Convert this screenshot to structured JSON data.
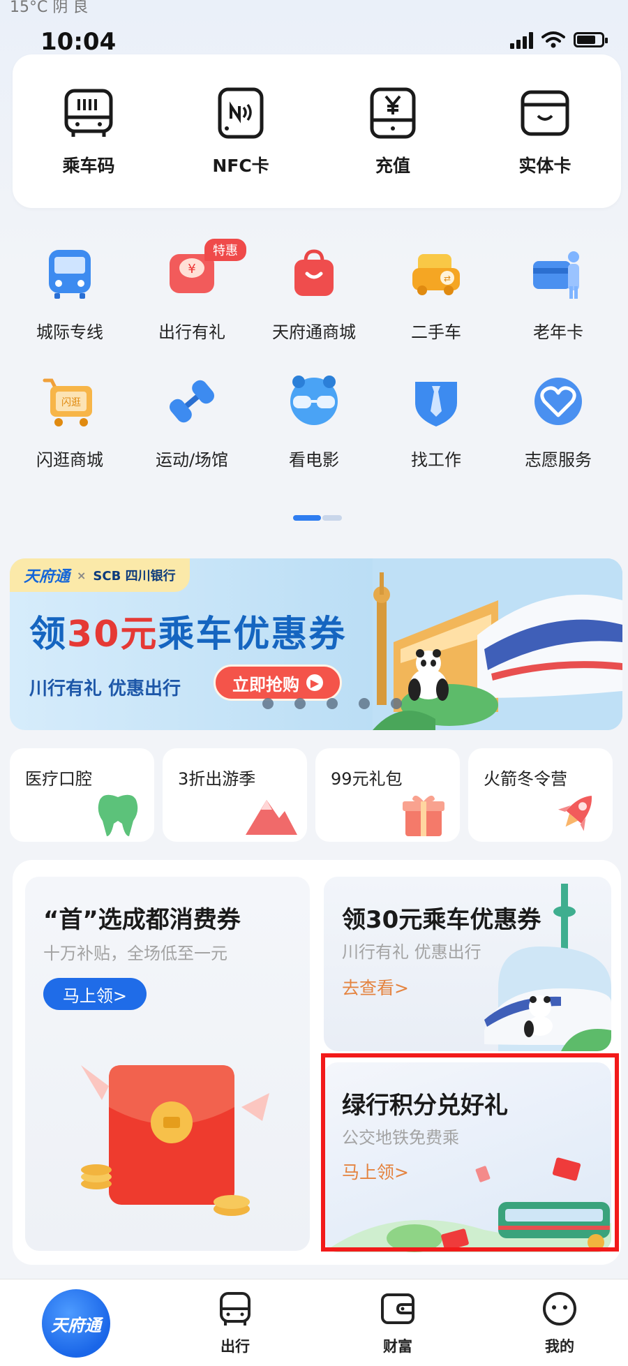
{
  "status": {
    "top_partial": "15°C  阴 良",
    "time": "10:04"
  },
  "top_actions": [
    {
      "label": "乘车码",
      "icon": "bus-qr-icon"
    },
    {
      "label": "NFC卡",
      "icon": "nfc-card-icon"
    },
    {
      "label": "充值",
      "icon": "yuan-recharge-icon"
    },
    {
      "label": "实体卡",
      "icon": "wallet-card-icon"
    }
  ],
  "services_row1": [
    {
      "label": "城际专线",
      "icon": "intercity-bus-icon"
    },
    {
      "label": "出行有礼",
      "icon": "red-envelope-gift-icon",
      "badge": "特惠"
    },
    {
      "label": "天府通商城",
      "icon": "shopping-bag-icon"
    },
    {
      "label": "二手车",
      "icon": "used-car-icon"
    },
    {
      "label": "老年卡",
      "icon": "senior-card-icon"
    }
  ],
  "services_row2": [
    {
      "label": "闪逛商城",
      "icon": "shopping-cart-icon"
    },
    {
      "label": "运动/场馆",
      "icon": "dumbbell-icon"
    },
    {
      "label": "看电影",
      "icon": "3d-glasses-icon"
    },
    {
      "label": "找工作",
      "icon": "tie-briefcase-icon"
    },
    {
      "label": "志愿服务",
      "icon": "heart-hand-icon"
    }
  ],
  "banner": {
    "brand": "天府通",
    "partner": "SCB 四川银行",
    "times": "×",
    "title_pre": "领",
    "title_amount": "30元",
    "title_post": "乘车优惠券",
    "subtitle": "川行有礼 优惠出行",
    "button": "立即抢购"
  },
  "categories": [
    {
      "label": "医疗口腔",
      "icon": "tooth-icon"
    },
    {
      "label": "3折出游季",
      "icon": "mountain-icon"
    },
    {
      "label": "99元礼包",
      "icon": "gift-box-icon"
    },
    {
      "label": "火箭冬令营",
      "icon": "rocket-icon"
    }
  ],
  "promo_left": {
    "title": "“首”选成都消费券",
    "subtitle": "十万补贴，全场低至一元",
    "button": "马上领>"
  },
  "promo_right_top": {
    "title": "领30元乘车优惠券",
    "subtitle": "川行有礼 优惠出行",
    "link": "去查看>"
  },
  "promo_right_bottom": {
    "title": "绿行积分兑好礼",
    "subtitle": "公交地铁免费乘",
    "link": "马上领>"
  },
  "tabbar": {
    "home": "天府通",
    "tabs": [
      {
        "label": "出行",
        "icon": "bus-front-icon"
      },
      {
        "label": "财富",
        "icon": "wallet-icon"
      },
      {
        "label": "我的",
        "icon": "smiley-face-icon"
      }
    ]
  },
  "colors": {
    "brand_blue": "#1f6ce8",
    "highlight_red": "#f21a1a",
    "link_orange": "#e4833f",
    "banner_red": "#f4544a"
  }
}
